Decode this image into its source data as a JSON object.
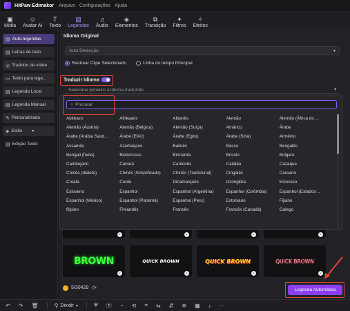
{
  "app": {
    "title": "HitPaw Edimakor",
    "menu": [
      "Arquivo",
      "Configurações",
      "Ajuda"
    ]
  },
  "toolbar": {
    "tools": [
      {
        "label": "Mídia",
        "icon": "media-icon"
      },
      {
        "label": "Avatar AI",
        "icon": "avatar-icon"
      },
      {
        "label": "Texto",
        "icon": "text-icon"
      },
      {
        "label": "Legendas",
        "icon": "captions-icon",
        "active": true
      },
      {
        "label": "Áudio",
        "icon": "audio-icon"
      },
      {
        "label": "Elementos",
        "icon": "elements-icon"
      },
      {
        "label": "Transição",
        "icon": "transition-icon"
      },
      {
        "label": "Filtros",
        "icon": "filters-icon"
      },
      {
        "label": "Efeitos",
        "icon": "effects-icon"
      }
    ]
  },
  "sidebar": {
    "items": [
      {
        "label": "Auto-legendas",
        "active": true
      },
      {
        "label": "Letras de Auto"
      },
      {
        "label": "Tradutor de vídeo"
      },
      {
        "label": "Texto para lege..."
      },
      {
        "label": "Legenda Local"
      },
      {
        "label": "Legenda Manual"
      },
      {
        "label": "Personalizado"
      },
      {
        "label": "Estilo"
      },
      {
        "label": "Edição Texto"
      }
    ]
  },
  "main": {
    "original_language_title": "Idioma Original",
    "original_language_value": "Auto Detecção",
    "radio_selected": "Rastrear Clipe Selecionado",
    "radio_other": "Linha do tempo Principal",
    "translate_title": "Traduzir Idioma",
    "translate_placeholder": "Selecione primeiro o idioma traduzido"
  },
  "popup": {
    "search_placeholder": "Procurar",
    "languages": [
      "Abkhazo",
      "Afrikaans",
      "Albanês",
      "Alemão",
      "Alemão (África do ...",
      "Alemão (Áustria)",
      "Alemão (Bélgica)",
      "Alemão (Suíça)",
      "Amárico",
      "Árabe",
      "Árabe (Arábia Saud...",
      "Árabe (EAU)",
      "Árabe (Egito)",
      "Árabe (Síria)",
      "Armênio",
      "Assamês",
      "Azerbaijano",
      "Balinês",
      "Basco",
      "Bengalês",
      "Bengali (Índia)",
      "Bielorrusso",
      "Birmanês",
      "Bósnio",
      "Búlgaro",
      "Cambojano",
      "Canará",
      "Cantonês",
      "Catalão",
      "Cazaque",
      "Chinês (dialeto)",
      "Chinês (Simplificado)",
      "Chinês (Tradicional)",
      "Cingalês",
      "Coreano",
      "Croata",
      "Curdo",
      "Dinamarquês",
      "Dzongkha",
      "Eslovaco",
      "Esloveno",
      "Espanhol",
      "Espanhol (Argentina)",
      "Espanhol (Colômbia)",
      "Espanhol (Estados ...",
      "Espanhol (México)",
      "Espanhol (Panamá)",
      "Espanhol (Peru)",
      "Estoniano",
      "Fijiano",
      "filipino",
      "Finlandês",
      "Francês",
      "Francês (Canadá)",
      "Galego"
    ]
  },
  "presets": {
    "cards": [
      "BROWN",
      "QUICK BROWN",
      "QUICK BROWN",
      "QUICK BROWN"
    ]
  },
  "footer": {
    "credits": "5/30429",
    "auto_button": "Legenda Automática"
  },
  "bottombar": {
    "split_label": "Dividir"
  },
  "colors": {
    "accent": "#8a3ff0",
    "highlight": "#e5453a"
  }
}
